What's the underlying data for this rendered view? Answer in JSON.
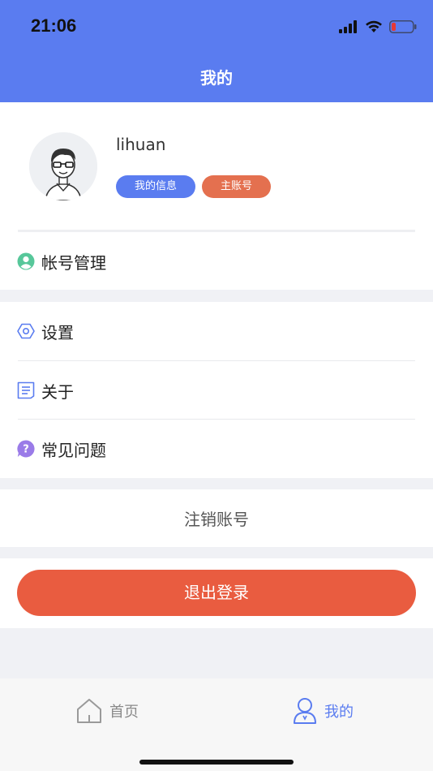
{
  "status_bar": {
    "time": "21:06"
  },
  "header": {
    "title": "我的"
  },
  "profile": {
    "username": "lihuan",
    "info_tag": "我的信息",
    "account_tag": "主账号"
  },
  "menu": {
    "account_management": "帐号管理",
    "settings": "设置",
    "about": "关于",
    "faq": "常见问题"
  },
  "cancel_account": "注销账号",
  "logout": "退出登录",
  "tabbar": {
    "home": "首页",
    "mine": "我的"
  },
  "colors": {
    "primary": "#5a7cf0",
    "danger": "#e95c40",
    "tag_orange": "#e4704f",
    "account_icon": "#57c79a",
    "faq_icon": "#9a7be8"
  }
}
